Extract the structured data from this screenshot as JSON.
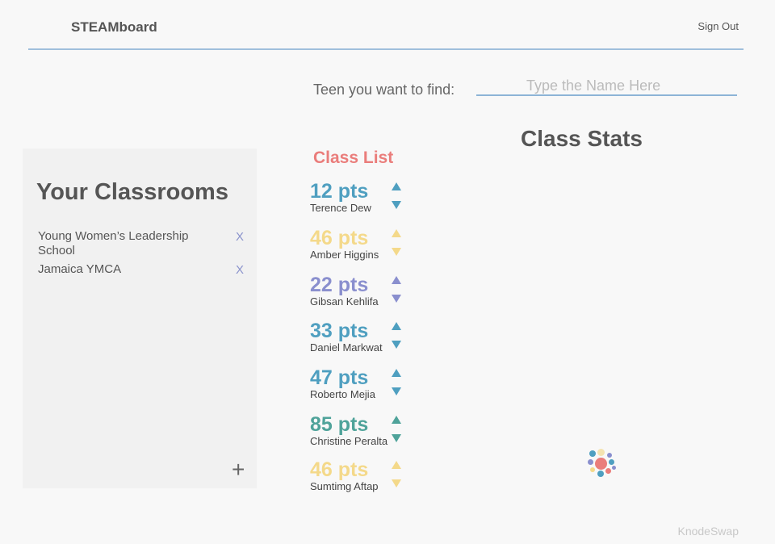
{
  "header": {
    "brand": "STEAMboard",
    "sign_out": "Sign Out"
  },
  "search": {
    "label": "Teen you want to find:",
    "placeholder": "Type the Name Here",
    "value": ""
  },
  "classrooms_panel": {
    "title": "Your Classrooms",
    "items": [
      {
        "name": "Young Women’s Leadership School",
        "remove": "X"
      },
      {
        "name": "Jamaica YMCA",
        "remove": "X"
      }
    ],
    "add": "+"
  },
  "class_list": {
    "title": "Class List",
    "title_color": "#ea7d7b",
    "students": [
      {
        "pts": "12 pts",
        "name": "Terence Dew",
        "color": "#4f9fc0"
      },
      {
        "pts": "46 pts",
        "name": "Amber Higgins",
        "color": "#f4d98a"
      },
      {
        "pts": "22 pts",
        "name": "Gibsan Kehlifa",
        "color": "#8a8fce"
      },
      {
        "pts": "33 pts",
        "name": "Daniel Markwat",
        "color": "#4f9fc0"
      },
      {
        "pts": "47 pts",
        "name": "Roberto Mejia",
        "color": "#4f9fc0"
      },
      {
        "pts": "85 pts",
        "name": "Christine Peralta",
        "color": "#4fa39a"
      },
      {
        "pts": "46 pts",
        "name": "Sumtimg Aftap",
        "color": "#f4d98a"
      }
    ]
  },
  "stats": {
    "title": "Class Stats"
  },
  "footer": {
    "brand": "KnodeSwap"
  }
}
